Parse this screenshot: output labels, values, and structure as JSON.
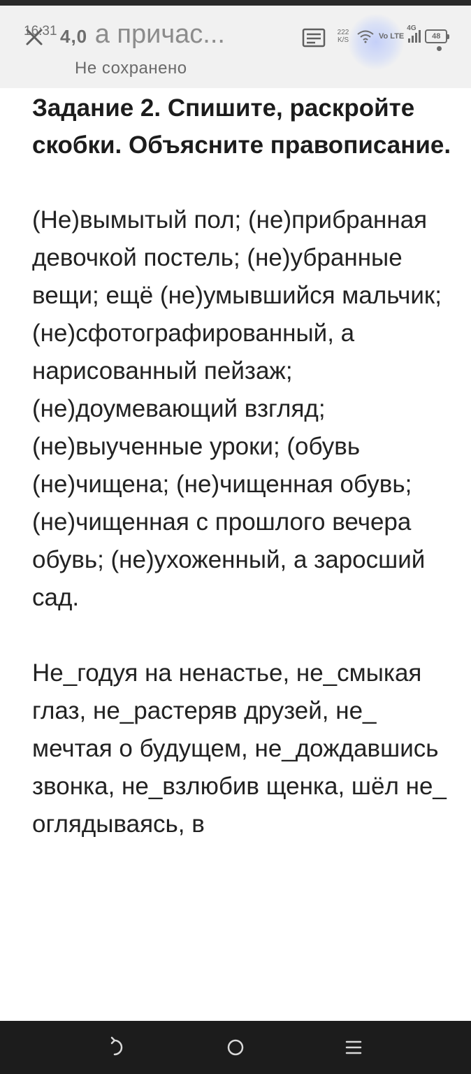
{
  "status_bar": {
    "time": "16:31",
    "network_speed_value": "222",
    "network_speed_unit": "K/S",
    "volte": "Vo LTE",
    "network_type": "4G",
    "battery": "48"
  },
  "header": {
    "title_fragment": "4,0",
    "title": "а причас...",
    "subtitle": "Не сохранено"
  },
  "document": {
    "heading": "Задание 2.  Спишите, раскройте скобки. Объясните правописание.",
    "paragraphs": [
      "(Не)вымытый пол; (не)прибранная девочкой постель; (не)убранные вещи; ещё (не)умывшийся мальчик; (не)сфотографированный, а нарисованный пейзаж; (не)доумевающий взгляд; (не)выученные уроки; (обувь (не)чищена; (не)чищенная обувь; (не)чищенная с прошлого вечера обувь; (не)ухоженный, а заросший сад.",
      "Не_годуя на ненастье, не_смыкая глаз, не_растеряв друзей, не_ мечтая о будущем, не_дождавшись звонка, не_взлюбив щенка, шёл не_ оглядываясь, в"
    ]
  },
  "colors": {
    "header_bg": "#f1f1f1",
    "nav_bg": "#1c1c1c",
    "text": "#222222",
    "touch_highlight": "#a0b4ff"
  },
  "icons": {
    "close": "close-icon",
    "format": "text-format-icon",
    "wifi": "wifi-icon",
    "back": "back-icon",
    "home": "home-icon",
    "menu": "menu-icon"
  }
}
